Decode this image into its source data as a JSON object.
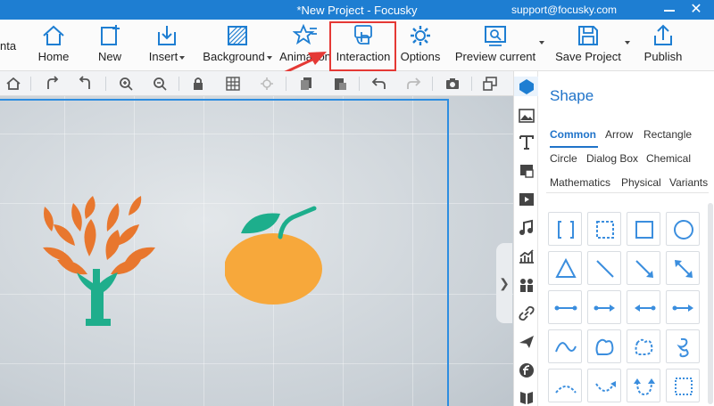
{
  "window": {
    "title": "*New Project - Focusky",
    "support": "support@focusky.com"
  },
  "ribbon": {
    "cut_label": "nta",
    "buttons": [
      {
        "label": "Home"
      },
      {
        "label": "New"
      },
      {
        "label": "Insert"
      },
      {
        "label": "Background"
      },
      {
        "label": "Animation"
      },
      {
        "label": "Interaction"
      },
      {
        "label": "Options"
      },
      {
        "label": "Preview current"
      },
      {
        "label": "Save Project"
      },
      {
        "label": "Publish"
      }
    ]
  },
  "subtoolbar": {
    "icons": [
      "home-icon",
      "rotate-right-icon",
      "rotate-left-icon",
      "zoom-in-icon",
      "zoom-out-icon",
      "lock-icon",
      "grid-icon",
      "settings-icon",
      "copy-icon",
      "paste-icon",
      "undo-icon",
      "redo-icon",
      "camera-icon",
      "window-icon"
    ]
  },
  "panel": {
    "title": "Shape",
    "categories": [
      {
        "label": "Common",
        "active": true
      },
      {
        "label": "Arrow"
      },
      {
        "label": "Rectangle"
      },
      {
        "label": "Circle"
      },
      {
        "label": "Dialog Box"
      },
      {
        "label": "Chemical"
      },
      {
        "label": "Mathematics"
      },
      {
        "label": "Physical"
      },
      {
        "label": "Variants"
      }
    ],
    "shapes": [
      "brackets",
      "dashed-rect",
      "rect",
      "circle",
      "triangle",
      "line",
      "arrow-line",
      "double-arrow-line",
      "dot-line",
      "dot-arrow-line",
      "arrow-dot-line",
      "arrow-arrow-line",
      "curve",
      "blob",
      "dashed-blob",
      "spiral",
      "arc-dashed",
      "arc-arrow",
      "u-arrow",
      "dashed-square"
    ]
  },
  "vtabs": [
    "shape-icon",
    "image-icon",
    "text-icon",
    "flag-icon",
    "video-icon",
    "music-icon",
    "chart-icon",
    "people-icon",
    "link-icon",
    "plane-icon",
    "flash-icon",
    "book-icon"
  ],
  "colors": {
    "accent": "#1e7ed2",
    "highlight": "#e53935",
    "tree": "#e8772e",
    "trunk": "#1fae8c",
    "orange": "#f7a83b",
    "leaf": "#1dae8c"
  }
}
